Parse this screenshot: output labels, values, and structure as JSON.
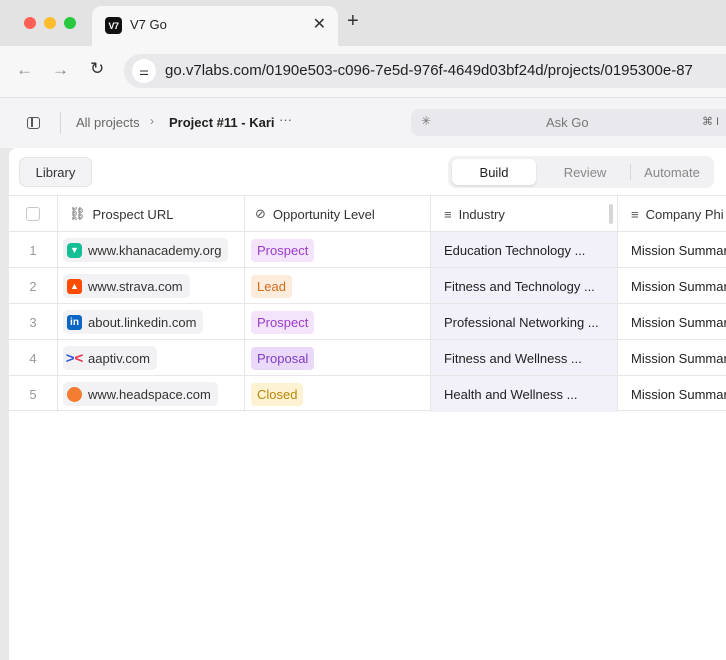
{
  "browser": {
    "tab_title": "V7 Go",
    "tab_favicon": "V7",
    "url": "go.v7labs.com/0190e503-c096-7e5d-976f-4649d03bf24d/projects/0195300e-87"
  },
  "header": {
    "breadcrumb_root": "All projects",
    "breadcrumb_current": "Project #11 - Kari",
    "more": "···",
    "ask_placeholder": "Ask Go",
    "ask_shortcut": "⌘ I"
  },
  "toolbar": {
    "library_label": "Library",
    "modes": [
      "Build",
      "Review",
      "Automate"
    ],
    "active_mode": "Build"
  },
  "table": {
    "columns": [
      "Prospect URL",
      "Opportunity Level",
      "Industry",
      "Company Phi"
    ],
    "rows": [
      {
        "num": "1",
        "url": "www.khanacademy.org",
        "icon": "khanacademy-icon",
        "level": "Prospect",
        "industry": "Education Technology ...",
        "company": "Mission Summar"
      },
      {
        "num": "2",
        "url": "www.strava.com",
        "icon": "strava-icon",
        "level": "Lead",
        "industry": "Fitness and Technology ...",
        "company": "Mission Summar"
      },
      {
        "num": "3",
        "url": "about.linkedin.com",
        "icon": "linkedin-icon",
        "level": "Prospect",
        "industry": "Professional Networking ...",
        "company": "Mission Summar"
      },
      {
        "num": "4",
        "url": "aaptiv.com",
        "icon": "aaptiv-icon",
        "level": "Proposal",
        "industry": "Fitness and Wellness ...",
        "company": "Mission Summar"
      },
      {
        "num": "5",
        "url": "www.headspace.com",
        "icon": "headspace-icon",
        "level": "Closed",
        "industry": "Health and Wellness ...",
        "company": "Mission Summar"
      }
    ]
  },
  "tag_colors": {
    "Prospect": {
      "bg": "#f3e3fb",
      "fg": "#9a3dc4"
    },
    "Lead": {
      "bg": "#fdecdc",
      "fg": "#d26a1c"
    },
    "Proposal": {
      "bg": "#ead9fb",
      "fg": "#7d3fc4"
    },
    "Closed": {
      "bg": "#fdf3d2",
      "fg": "#b8870c"
    }
  }
}
